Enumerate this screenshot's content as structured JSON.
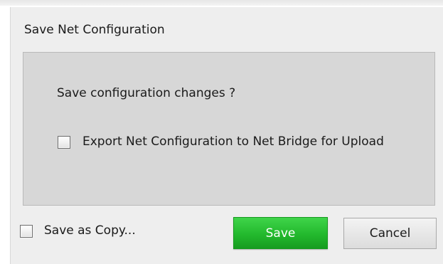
{
  "dialog": {
    "title": "Save Net Configuration",
    "question": "Save configuration changes ?",
    "export_checkbox": {
      "label": "Export Net Configuration to Net Bridge for Upload",
      "checked": false
    },
    "copy_checkbox": {
      "label": "Save as Copy...",
      "checked": false
    },
    "buttons": {
      "save_label": "Save",
      "cancel_label": "Cancel"
    }
  },
  "colors": {
    "save_button": "#23b92d",
    "panel": "#d7d7d7",
    "frame": "#eeeeee"
  }
}
